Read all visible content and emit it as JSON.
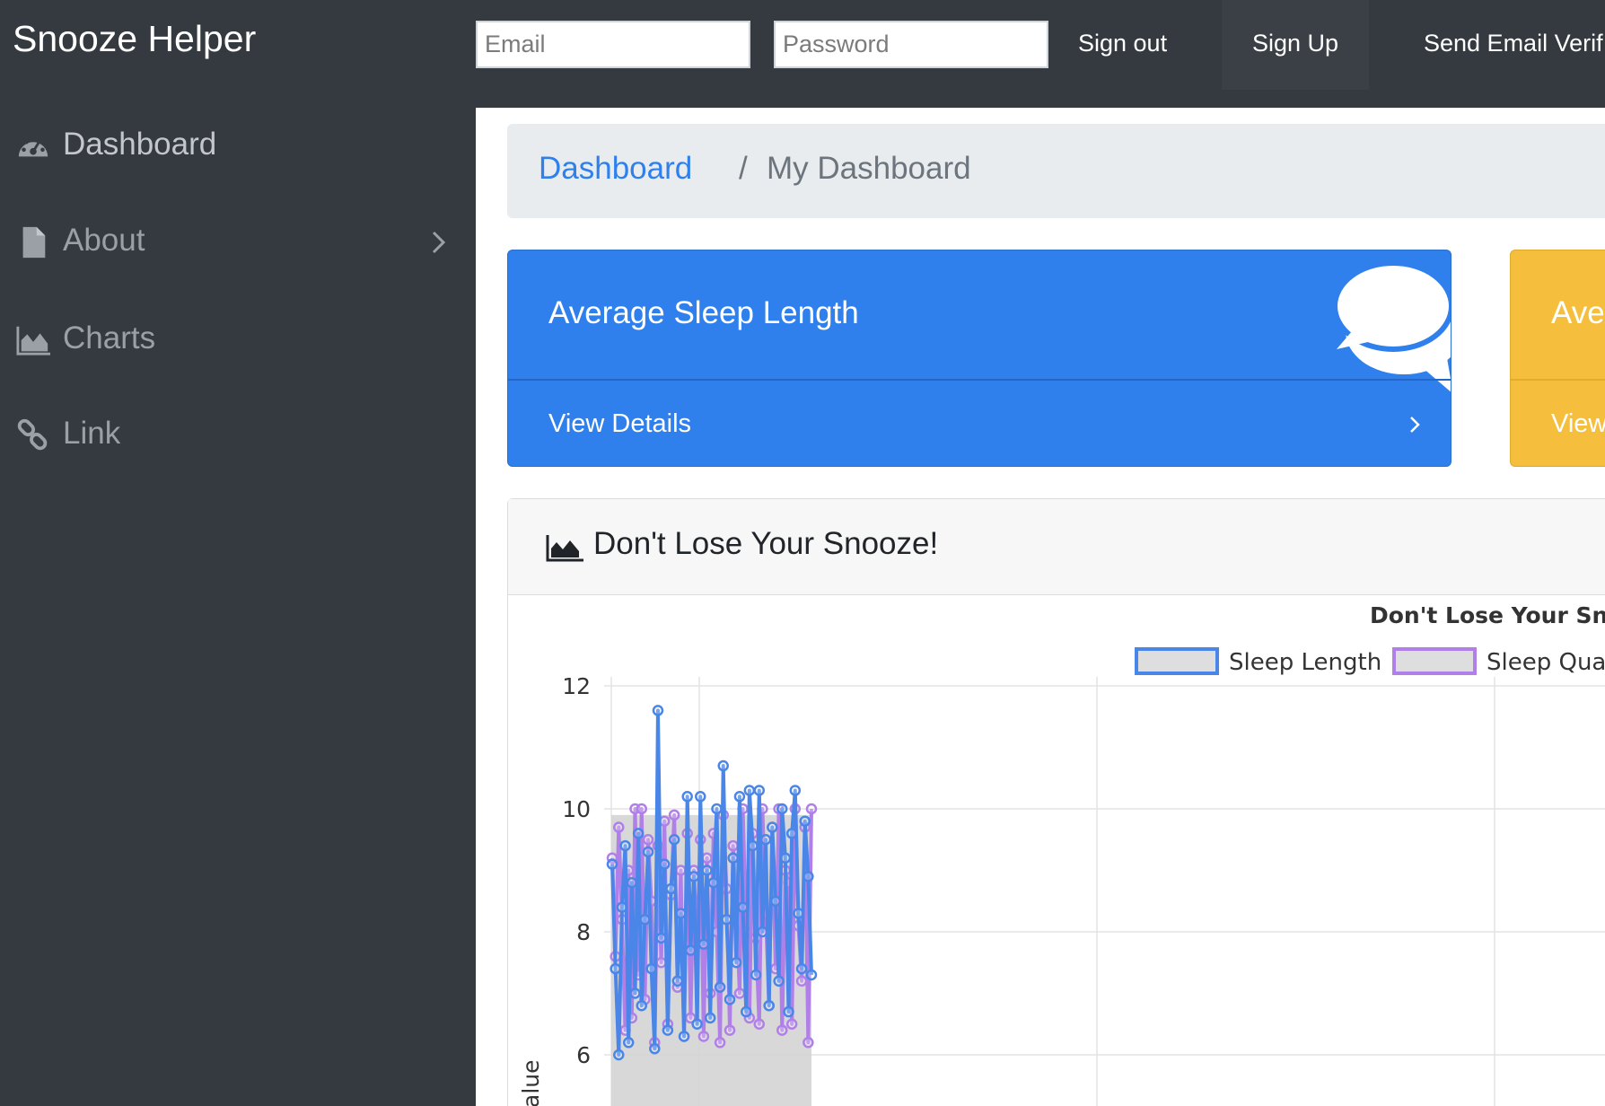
{
  "navbar": {
    "brand": "Snooze Helper",
    "email_placeholder": "Email",
    "password_placeholder": "Password",
    "sign_out": "Sign out",
    "sign_up": "Sign Up",
    "send_verification": "Send Email Verif"
  },
  "sidebar": {
    "items": [
      {
        "label": "Dashboard",
        "icon": "tachometer-icon"
      },
      {
        "label": "About",
        "icon": "file-icon"
      },
      {
        "label": "Charts",
        "icon": "area-chart-icon"
      },
      {
        "label": "Link",
        "icon": "link-icon"
      }
    ]
  },
  "breadcrumb": {
    "root": "Dashboard",
    "separator": "/",
    "current": "My Dashboard"
  },
  "cards": [
    {
      "title": "Average Sleep Length",
      "footer": "View Details",
      "color": "#2f80ed"
    },
    {
      "title": "Ave",
      "footer": "View",
      "color": "#f5bf3d"
    }
  ],
  "chart_panel": {
    "header": "Don't Lose Your Snooze!"
  },
  "colors": {
    "sidebar_bg": "#343a40",
    "primary": "#2f80ed",
    "warning": "#f5bf3d",
    "series1": "#4a86e8",
    "series2": "#b07fe8"
  },
  "chart_data": {
    "type": "line",
    "title": "Don't Lose Your Snooz",
    "ylabel": "alue",
    "ylim": [
      6,
      12
    ],
    "yticks": [
      "12",
      "10",
      "8",
      "6"
    ],
    "series": [
      {
        "name": "Sleep Length",
        "color": "#4a86e8",
        "values": [
          9.1,
          7.4,
          6.0,
          8.4,
          9.4,
          6.2,
          8.8,
          7.0,
          9.6,
          6.8,
          8.2,
          9.3,
          7.4,
          6.1,
          11.6,
          7.9,
          9.1,
          6.4,
          8.7,
          9.5,
          7.2,
          8.3,
          6.3,
          10.2,
          7.7,
          8.9,
          6.5,
          10.2,
          7.8,
          9.0,
          6.6,
          8.8,
          10.0,
          7.1,
          10.7,
          8.2,
          6.9,
          9.2,
          7.5,
          10.2,
          8.4,
          6.7,
          10.3,
          9.4,
          7.3,
          10.3,
          8.0,
          9.5,
          6.8,
          9.7,
          8.5,
          7.2,
          10.0,
          9.2,
          6.7,
          9.6,
          10.3,
          8.3,
          7.4,
          9.8,
          8.9,
          7.3
        ]
      },
      {
        "name": "Sleep Quality",
        "color": "#b07fe8",
        "values": [
          9.2,
          7.6,
          9.7,
          8.2,
          6.4,
          9.0,
          6.6,
          10.0,
          7.3,
          10.0,
          6.9,
          9.5,
          8.5,
          6.2,
          9.4,
          7.5,
          9.8,
          6.5,
          8.6,
          9.9,
          7.1,
          9.0,
          6.3,
          9.6,
          6.6,
          9.0,
          7.8,
          9.5,
          6.3,
          9.2,
          7.0,
          9.6,
          8.0,
          6.2,
          9.9,
          8.7,
          6.4,
          9.4,
          8.4,
          7.0,
          10.0,
          8.0,
          6.6,
          9.6,
          7.9,
          6.5,
          10.0,
          8.3,
          6.8,
          9.7,
          7.4,
          10.0,
          6.4,
          9.0,
          8.8,
          6.5,
          10.0,
          8.1,
          7.2,
          9.7,
          6.2,
          10.0
        ]
      }
    ]
  }
}
